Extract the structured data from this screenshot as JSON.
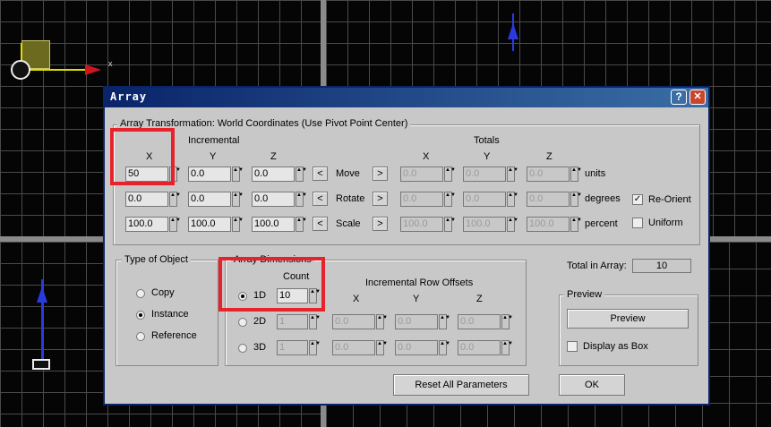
{
  "dialog": {
    "title": "Array",
    "help_label": "?",
    "close_label": "✕"
  },
  "transform": {
    "group_label": "Array Transformation: World Coordinates (Use Pivot Point Center)",
    "incremental_label": "Incremental",
    "totals_label": "Totals",
    "axis_x": "X",
    "axis_y": "Y",
    "axis_z": "Z",
    "rows": [
      {
        "inc": [
          "50",
          "0.0",
          "0.0"
        ],
        "name": "Move",
        "tot": [
          "0.0",
          "0.0",
          "0.0"
        ],
        "unit": "units"
      },
      {
        "inc": [
          "0.0",
          "0.0",
          "0.0"
        ],
        "name": "Rotate",
        "tot": [
          "0.0",
          "0.0",
          "0.0"
        ],
        "unit": "degrees"
      },
      {
        "inc": [
          "100.0",
          "100.0",
          "100.0"
        ],
        "name": "Scale",
        "tot": [
          "100.0",
          "100.0",
          "100.0"
        ],
        "unit": "percent"
      }
    ],
    "arrow_left": "<",
    "arrow_right": ">",
    "reorient_label": "Re-Orient",
    "reorient_checked": true,
    "uniform_label": "Uniform",
    "uniform_checked": false
  },
  "object_type": {
    "group_label": "Type of Object",
    "options": [
      "Copy",
      "Instance",
      "Reference"
    ],
    "selected": "Instance"
  },
  "dimensions": {
    "group_label": "Array Dimensions",
    "count_label": "Count",
    "offsets_label": "Incremental Row Offsets",
    "axis_x": "X",
    "axis_y": "Y",
    "axis_z": "Z",
    "rows": [
      {
        "label": "1D",
        "count": "10",
        "offsets": []
      },
      {
        "label": "2D",
        "count": "1",
        "offsets": [
          "0.0",
          "0.0",
          "0.0"
        ]
      },
      {
        "label": "3D",
        "count": "1",
        "offsets": [
          "0.0",
          "0.0",
          "0.0"
        ]
      }
    ],
    "selected": "1D"
  },
  "total": {
    "label": "Total in Array:",
    "value": "10"
  },
  "preview": {
    "group_label": "Preview",
    "button_label": "Preview",
    "display_as_box_label": "Display as Box",
    "display_as_box_checked": false
  },
  "buttons": {
    "reset_label": "Reset All Parameters",
    "ok_label": "OK"
  },
  "viewport": {
    "axis_x_label": "x"
  },
  "colors": {
    "highlight": "#e8222c",
    "title_bar": "#0a246a",
    "viewport_grid": "#4a4a4a"
  }
}
